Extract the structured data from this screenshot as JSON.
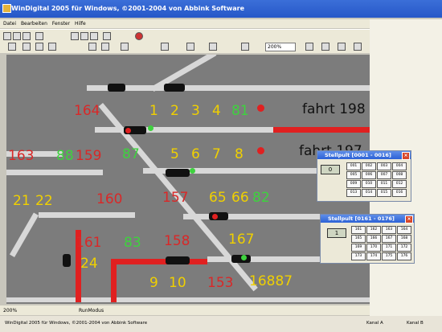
{
  "window": {
    "title": "WinDigital 2005 für Windows, ©2001-2004 von Abbink Software"
  },
  "menu": [
    "Datei",
    "Bearbeiten",
    "Fenster",
    "Hilfe"
  ],
  "toolbar": {
    "zoom_value": "200%"
  },
  "status": {
    "zoom": "200%",
    "mode": "RunModus"
  },
  "taskbar": {
    "task": "WinDigital 2005 für Windows, ©2001-2004 von Abbink Software",
    "kanal_a": "Kanal A",
    "kanal_b": "Kanal B"
  },
  "labels": {
    "n164": "164",
    "n1": "1",
    "n2": "2",
    "n3": "3",
    "n4": "4",
    "n81": "81",
    "fahrt1": "fahrt 198",
    "n163": "163",
    "n88": "88",
    "n159": "159",
    "n87": "87",
    "n5": "5",
    "n6": "6",
    "n7": "7",
    "n8": "8",
    "fahrt2": "fahrt 197",
    "n21": "21",
    "n22": "22",
    "n160": "160",
    "n157": "157",
    "n65": "65",
    "n66": "66",
    "n82": "82",
    "n161": "161",
    "n83": "83",
    "n158": "158",
    "n167": "167",
    "n24": "24",
    "n9": "9",
    "n10": "10",
    "n153": "153",
    "n168": "16887"
  },
  "pult1": {
    "title": "Stellpult [0001 - 0016]",
    "display": "0",
    "buttons": [
      "001",
      "002",
      "003",
      "004",
      "005",
      "006",
      "007",
      "008",
      "009",
      "010",
      "011",
      "012",
      "013",
      "014",
      "015",
      "016"
    ]
  },
  "pult2": {
    "title": "Stellpult [0161 - 0176]",
    "display": "1",
    "buttons": [
      "161",
      "162",
      "163",
      "164",
      "165",
      "166",
      "167",
      "168",
      "169",
      "170",
      "171",
      "172",
      "173",
      "174",
      "175",
      "176"
    ]
  },
  "colors": {
    "red": "#d92828",
    "yellow": "#f0d000",
    "green": "#3ed23e",
    "track": "#d8d8d8",
    "background": "#7c7c7c"
  }
}
